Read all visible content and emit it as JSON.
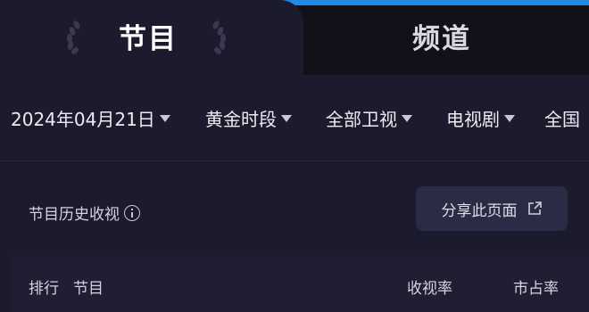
{
  "tabs": {
    "active_label": "节目",
    "inactive_label": "频道"
  },
  "filters": [
    {
      "label": "2024年04月21日"
    },
    {
      "label": "黄金时段"
    },
    {
      "label": "全部卫视"
    },
    {
      "label": "电视剧"
    },
    {
      "label": "全国"
    }
  ],
  "section": {
    "title": "节目历史收视",
    "share_label": "分享此页面"
  },
  "table": {
    "col_rank": "排行",
    "col_program": "节目",
    "col_rating": "收视率",
    "col_share": "市占率"
  },
  "colors": {
    "background": "#1c1b2e",
    "inactive_tab": "#11111a",
    "accent": "#1e8be6",
    "button_bg": "#2a2c45"
  }
}
